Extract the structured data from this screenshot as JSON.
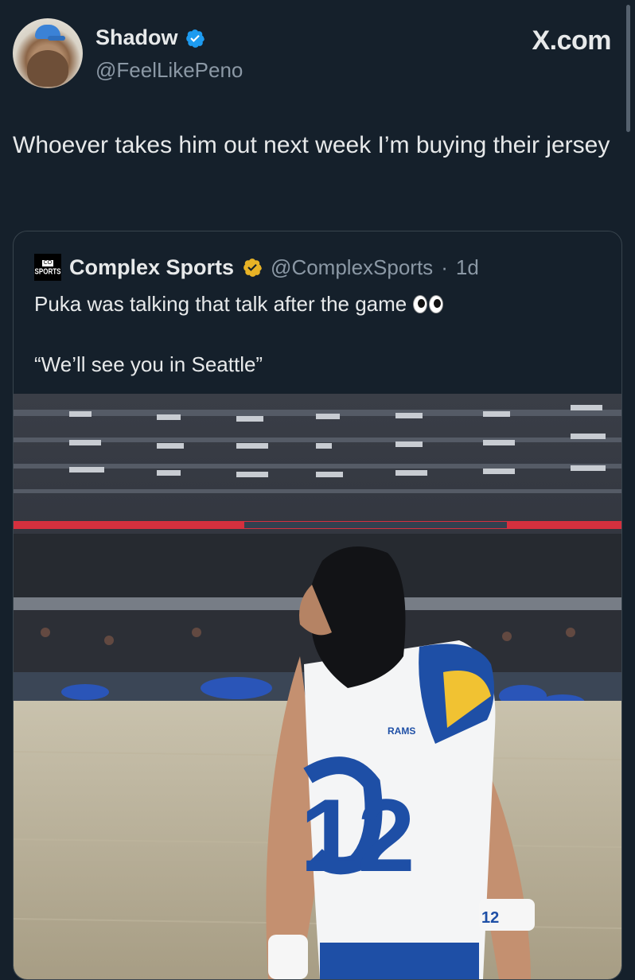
{
  "author": {
    "display_name": "Shadow",
    "handle": "@FeelLikePeno",
    "verified": true,
    "verified_color": "#1d9bf0",
    "avatar_icon": "avatar-dog-blue-cap"
  },
  "site_logo": "X.com",
  "tweet": {
    "text": "Whoever takes him out next week I’m buying their jersey"
  },
  "quoted_tweet": {
    "logo_mini": "CO",
    "logo_text": "SPORTS",
    "display_name": "Complex Sports",
    "verified_color": "#e8b326",
    "handle": "@ComplexSports",
    "separator": "·",
    "time": "1d",
    "line1": "Puka was talking that talk after the game",
    "emoji": "eyes-emoji",
    "line2": "“We’ll see you in Seattle”",
    "media": {
      "jersey_brand": "RAMS",
      "jersey_number": "12",
      "wristband_number": "12"
    }
  },
  "colors": {
    "background": "#15202b",
    "text_primary": "#e7e9ea",
    "text_secondary": "#8b98a5",
    "border": "#38444d"
  }
}
